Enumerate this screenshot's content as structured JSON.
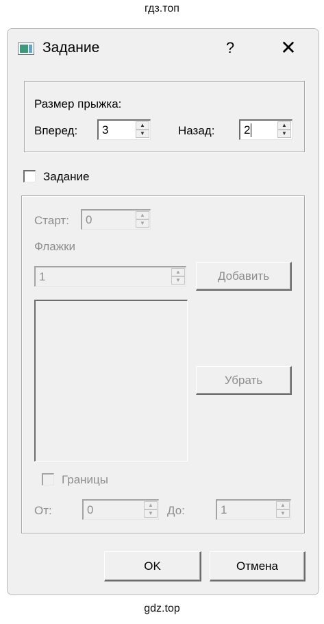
{
  "watermark_top": "гдз.топ",
  "watermark_bottom": "gdz.top",
  "dialog": {
    "title": "Задание",
    "help_glyph": "?",
    "close_glyph": "✕"
  },
  "jump": {
    "group_label": "Размер прыжка:",
    "forward_label": "Вперед:",
    "forward_value": "3",
    "back_label": "Назад:",
    "back_value": "2"
  },
  "task": {
    "checkbox_label": "Задание",
    "checked": false,
    "start_label": "Старт:",
    "start_value": "0",
    "flags_label": "Флажки",
    "flags_value": "1",
    "add_button": "Добавить",
    "remove_button": "Убрать",
    "bounds_label": "Границы",
    "bounds_checked": false,
    "from_label": "От:",
    "from_value": "0",
    "to_label": "До:",
    "to_value": "1"
  },
  "buttons": {
    "ok": "OK",
    "cancel": "Отмена"
  },
  "icons": {
    "spin_up": "▲",
    "spin_down": "▼"
  }
}
